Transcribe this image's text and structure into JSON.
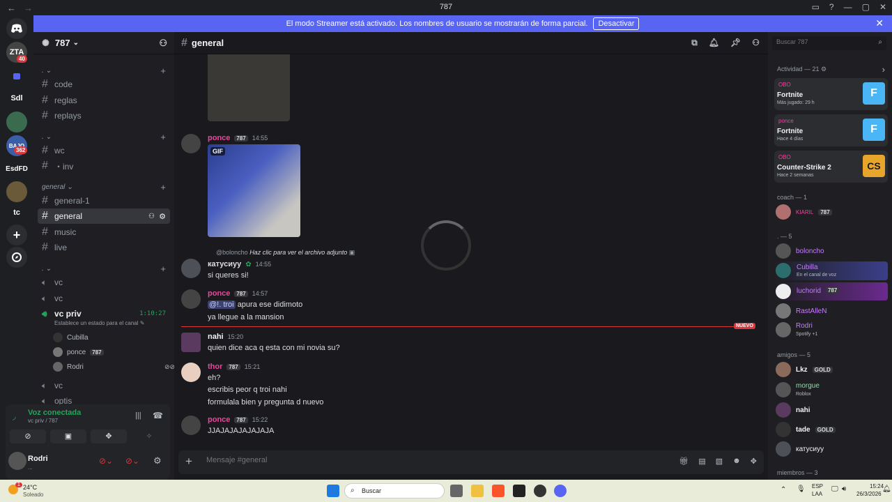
{
  "window": {
    "title": "787"
  },
  "banner": {
    "text": "El modo Streamer está activado. Los nombres de usuario se mostrarán de forma parcial.",
    "button": "Desactivar"
  },
  "rail": {
    "servers": [
      "ZTA",
      "Sdl",
      "BAJO",
      "EsdFD",
      "tc"
    ],
    "badges": [
      "40",
      "362"
    ]
  },
  "server": {
    "name": "787"
  },
  "channels": {
    "cat1": "⌄",
    "text1": [
      "code",
      "reglas",
      "replays"
    ],
    "text2": [
      "wc",
      "・inv"
    ],
    "cat_general": "general",
    "text3": [
      "general-1",
      "general",
      "music",
      "live"
    ],
    "voice": [
      "vc",
      "vc",
      "vc priv",
      "vc",
      "optis"
    ],
    "vc_priv_time": "1:10:27",
    "vc_priv_status": "Establece un estado para el canal",
    "vc_users": [
      "Cubilla",
      "ponce",
      "Rodri"
    ]
  },
  "voice_panel": {
    "status": "Voz conectada",
    "location": "vc priv / 787",
    "user": "Rodri",
    "user_sub": "..."
  },
  "chat": {
    "channel": "general",
    "placeholder": "Mensaje #general",
    "messages": [
      {
        "name": "ponce",
        "time": "14:55",
        "tag": "787",
        "gif": "GIF"
      },
      {
        "reply": "@boloncho",
        "reply_text": "Haz clic para ver el archivo adjunto",
        "name": "катусиуу",
        "time": "14:55",
        "lines": [
          "si queres si!"
        ]
      },
      {
        "name": "ponce",
        "time": "14:57",
        "tag": "787",
        "mention": "@!. troi",
        "lines": [
          "apura ese didimoto",
          "ya llegue a la mansion"
        ]
      },
      {
        "name": "nahi",
        "time": "15:20",
        "lines": [
          "quien dice aca q esta con mi novia su?"
        ]
      },
      {
        "name": "thor",
        "time": "15:21",
        "tag": "787",
        "lines": [
          "eh?",
          "escribis peor q troi nahi",
          "formulala bien y pregunta d nuevo"
        ]
      },
      {
        "name": "ponce",
        "time": "15:22",
        "tag": "787",
        "lines": [
          "JJAJAJAJAJAJAJA"
        ]
      }
    ],
    "new_label": "NUEVO"
  },
  "search": {
    "placeholder": "Buscar 787"
  },
  "members": {
    "activity_header": "Actividad — 21",
    "activities": [
      {
        "user": "OBO",
        "game": "Fortnite",
        "sub": "Más jugado: 29 h"
      },
      {
        "user": "ponce",
        "game": "Fortnite",
        "sub": "Hace 4 días"
      },
      {
        "user": "OBO",
        "game": "Counter-Strike 2",
        "sub": "Hace 2 semanas"
      }
    ],
    "coach_header": "coach — 1",
    "coach": [
      {
        "name": "KIARIL",
        "tag": "787"
      }
    ],
    "dot_header": ". — 5",
    "dot": [
      {
        "name": "boloncho",
        "sub": ""
      },
      {
        "name": "Cubilla",
        "sub": "En el canal de voz"
      },
      {
        "name": "luchorid",
        "sub": "",
        "tag": "787"
      },
      {
        "name": "RastAlleN",
        "sub": ""
      },
      {
        "name": "Rodri",
        "sub": "Spotify +1"
      }
    ],
    "amigos_header": "amigos — 5",
    "amigos": [
      {
        "name": "Lkz",
        "tag": "GOLD",
        "sub": ""
      },
      {
        "name": "morgue",
        "sub": "Roblox"
      },
      {
        "name": "nahi",
        "sub": ""
      },
      {
        "name": "tade",
        "tag": "GOLD",
        "sub": ""
      },
      {
        "name": "катусиуу",
        "sub": ""
      }
    ],
    "miembros_header": "miembros — 3"
  },
  "taskbar": {
    "weather_temp": "24°C",
    "weather_desc": "Soleado",
    "search": "Buscar",
    "lang1": "ESP",
    "lang2": "LAA",
    "time": "15:24",
    "date": "26/3/2026",
    "notif": "1"
  },
  "colors": {
    "accent": "#5865f2",
    "bg": "#1a1a1e",
    "pink": "#eb459e",
    "green": "#23a55a",
    "red": "#da373c"
  }
}
